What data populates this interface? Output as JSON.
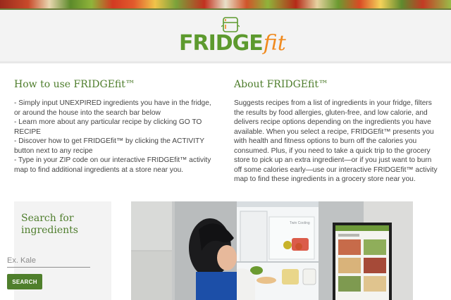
{
  "brand": {
    "logo_fridge": "FRIDGE",
    "logo_fit": "fit"
  },
  "colors": {
    "brand_green": "#5d9a2e",
    "brand_orange": "#f08a1e",
    "heading_green": "#4e7d2c",
    "button_green": "#4f7f2c"
  },
  "how_to": {
    "title": "How to use FRIDGEfit™",
    "items": [
      "- Simply input UNEXPIRED ingredients you have in the fridge, or around the house into the search bar below",
      "- Learn more about any particular recipe by clicking GO TO RECIPE",
      "- Discover how to get FRIDGEfit™ by clicking the ACTIVITY button next to any recipe",
      "- Type in your ZIP code on our interactive FRIDGEfit™ activity map to find additional ingredients at a store near you."
    ]
  },
  "about": {
    "title": "About FRIDGEfit™",
    "body": "Suggests recipes from a list of ingredients in your fridge, filters the results by food allergies, gluten-free, and low calorie, and delivers recipe options depending on the ingredients you have available. When you select a recipe, FRIDGEfit™ presents you with health and fitness options to burn off the calories you consumed. Plus, if you need to take a quick trip to the grocery store to pick up an extra ingredient—or if you just want to burn off some calories early—use our interactive FRIDGEfit™ activity map to find these ingredients in a grocery store near you."
  },
  "search": {
    "title": "Search for ingredients",
    "placeholder": "Ex. Kale",
    "button_label": "SEARCH"
  },
  "hero": {
    "fridge_label": "Twin Cooling"
  },
  "icons": [
    "fridge-logo-icon"
  ]
}
